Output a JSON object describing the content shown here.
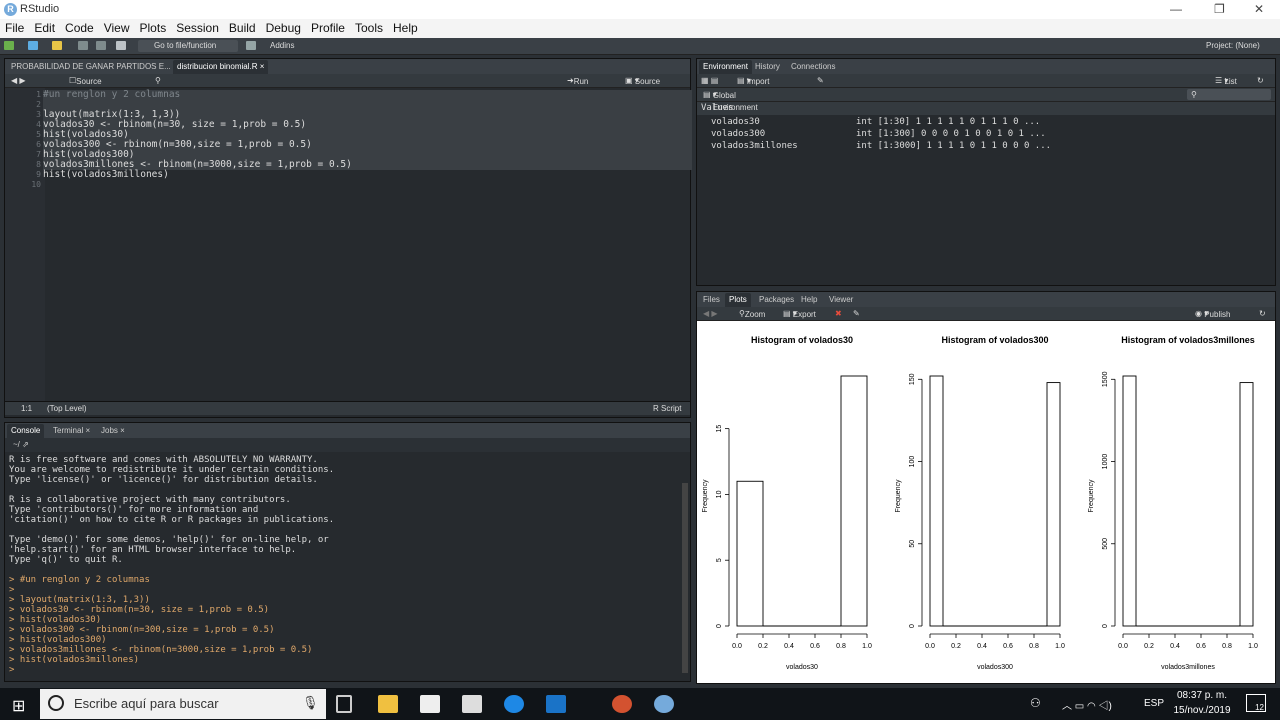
{
  "window": {
    "title": "RStudio",
    "logo": "R"
  },
  "menu": [
    "File",
    "Edit",
    "Code",
    "View",
    "Plots",
    "Session",
    "Build",
    "Debug",
    "Profile",
    "Tools",
    "Help"
  ],
  "toolbar": {
    "goto_placeholder": "Go to file/function",
    "addins": "Addins",
    "project": "Project: (None)"
  },
  "source": {
    "tabs": [
      "PROBABILIDAD DE GANAR PARTIDOS E...",
      "distribucion binomial.R"
    ],
    "source_on_save": "Source on Save",
    "run": "Run",
    "source_btn": "Source",
    "lines": [
      "#un renglon y 2 columnas",
      "",
      "layout(matrix(1:3, 1,3))",
      "volados30 <- rbinom(n=30, size = 1,prob = 0.5)",
      "hist(volados30)",
      "volados300 <- rbinom(n=300,size = 1,prob = 0.5)",
      "hist(volados300)",
      "volados3millones <- rbinom(n=3000,size = 1,prob = 0.5)",
      "hist(volados3millones)",
      ""
    ],
    "line_numbers": [
      "1",
      "2",
      "3",
      "4",
      "5",
      "6",
      "7",
      "8",
      "9",
      "10"
    ],
    "status_pos": "1:1",
    "status_level": "(Top Level)",
    "status_type": "R Script"
  },
  "console": {
    "tabs": [
      "Console",
      "Terminal",
      "Jobs"
    ],
    "path": "~/",
    "lines": [
      "R is free software and comes with ABSOLUTELY NO WARRANTY.",
      "You are welcome to redistribute it under certain conditions.",
      "Type 'license()' or 'licence()' for distribution details.",
      "",
      "R is a collaborative project with many contributors.",
      "Type 'contributors()' for more information and",
      "'citation()' on how to cite R or R packages in publications.",
      "",
      "Type 'demo()' for some demos, 'help()' for on-line help, or",
      "'help.start()' for an HTML browser interface to help.",
      "Type 'q()' to quit R.",
      ""
    ],
    "commands": [
      "> #un renglon y 2 columnas",
      ">",
      "> layout(matrix(1:3, 1,3))",
      "> volados30 <- rbinom(n=30, size = 1,prob = 0.5)",
      "> hist(volados30)",
      "> volados300 <- rbinom(n=300,size = 1,prob = 0.5)",
      "> hist(volados300)",
      "> volados3millones <- rbinom(n=3000,size = 1,prob = 0.5)",
      "> hist(volados3millones)",
      ">"
    ]
  },
  "environment": {
    "tabs": [
      "Environment",
      "History",
      "Connections"
    ],
    "import": "Import Dataset",
    "list": "List",
    "scope": "Global Environment",
    "section": "Values",
    "values": [
      {
        "name": "volados30",
        "value": "int [1:30] 1 1 1 1 1 0 1 1 1 0 ..."
      },
      {
        "name": "volados300",
        "value": "int [1:300] 0 0 0 0 1 0 0 1 0 1 ..."
      },
      {
        "name": "volados3millones",
        "value": "int [1:3000] 1 1 1 1 0 1 1 0 0 0 ..."
      }
    ]
  },
  "files": {
    "tabs": [
      "Files",
      "Plots",
      "Packages",
      "Help",
      "Viewer"
    ],
    "zoom": "Zoom",
    "export": "Export",
    "publish": "Publish"
  },
  "chart_data": [
    {
      "type": "bar",
      "title": "Histogram of volados30",
      "xlabel": "volados30",
      "ylabel": "Frequency",
      "bins": [
        [
          0.0,
          0.2
        ],
        [
          0.8,
          1.0
        ]
      ],
      "values": [
        11,
        19
      ],
      "xlim": [
        0,
        1
      ],
      "ylim": [
        0,
        19
      ],
      "xticks": [
        "0.0",
        "0.2",
        "0.4",
        "0.6",
        "0.8",
        "1.0"
      ],
      "yticks": [
        "0",
        "5",
        "10",
        "15"
      ]
    },
    {
      "type": "bar",
      "title": "Histogram of volados300",
      "xlabel": "volados300",
      "ylabel": "Frequency",
      "bins": [
        [
          0.0,
          0.1
        ],
        [
          0.9,
          1.0
        ]
      ],
      "values": [
        152,
        148
      ],
      "xlim": [
        0,
        1
      ],
      "ylim": [
        0,
        152
      ],
      "xticks": [
        "0.0",
        "0.2",
        "0.4",
        "0.6",
        "0.8",
        "1.0"
      ],
      "yticks": [
        "0",
        "50",
        "100",
        "150"
      ]
    },
    {
      "type": "bar",
      "title": "Histogram of volados3millones",
      "xlabel": "volados3millones",
      "ylabel": "Frequency",
      "bins": [
        [
          0.0,
          0.1
        ],
        [
          0.9,
          1.0
        ]
      ],
      "values": [
        1520,
        1480
      ],
      "xlim": [
        0,
        1
      ],
      "ylim": [
        0,
        1520
      ],
      "xticks": [
        "0.0",
        "0.2",
        "0.4",
        "0.6",
        "0.8",
        "1.0"
      ],
      "yticks": [
        "0",
        "500",
        "1000",
        "1500"
      ]
    }
  ],
  "taskbar": {
    "search_placeholder": "Escribe aquí para buscar",
    "lang": "ESP",
    "time": "08:37 p. m.",
    "date": "15/nov./2019",
    "notifications": "12"
  }
}
